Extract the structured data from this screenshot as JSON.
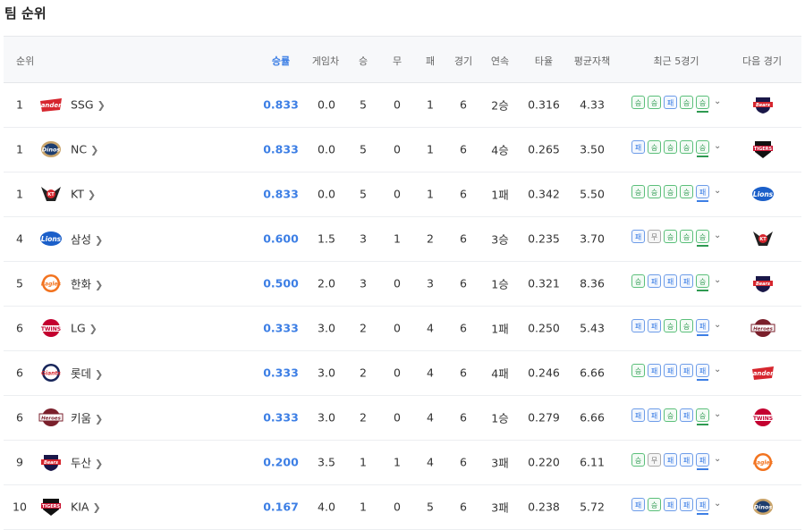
{
  "page": {
    "title": "팀 순위"
  },
  "headers": {
    "rank": "순위",
    "pct": "승률",
    "gb": "게임차",
    "w": "승",
    "d": "무",
    "l": "패",
    "g": "경기",
    "streak": "연속",
    "avg": "타율",
    "era": "평균자책",
    "recent": "최근 5경기",
    "next": "다음 경기"
  },
  "result_labels": {
    "W": "승",
    "L": "패",
    "D": "무"
  },
  "colors": {
    "accent": "#3d7fe5",
    "win": "#2f9a52",
    "loss": "#3d7fe5",
    "draw": "#777777"
  },
  "teams": [
    {
      "rank": "1",
      "name": "SSG",
      "pct": "0.833",
      "gb": "0.0",
      "w": "5",
      "d": "0",
      "l": "1",
      "g": "6",
      "streak": "2승",
      "avg": "0.316",
      "era": "4.33",
      "recent": [
        "W",
        "W",
        "L",
        "W",
        "W"
      ],
      "logo": "ssg-logo-icon",
      "next": "doosan-logo-icon"
    },
    {
      "rank": "1",
      "name": "NC",
      "pct": "0.833",
      "gb": "0.0",
      "w": "5",
      "d": "0",
      "l": "1",
      "g": "6",
      "streak": "4승",
      "avg": "0.265",
      "era": "3.50",
      "recent": [
        "L",
        "W",
        "W",
        "W",
        "W"
      ],
      "logo": "nc-logo-icon",
      "next": "kia-logo-icon"
    },
    {
      "rank": "1",
      "name": "KT",
      "pct": "0.833",
      "gb": "0.0",
      "w": "5",
      "d": "0",
      "l": "1",
      "g": "6",
      "streak": "1패",
      "avg": "0.342",
      "era": "5.50",
      "recent": [
        "W",
        "W",
        "W",
        "W",
        "L"
      ],
      "logo": "kt-logo-icon",
      "next": "samsung-logo-icon"
    },
    {
      "rank": "4",
      "name": "삼성",
      "pct": "0.600",
      "gb": "1.5",
      "w": "3",
      "d": "1",
      "l": "2",
      "g": "6",
      "streak": "3승",
      "avg": "0.235",
      "era": "3.70",
      "recent": [
        "L",
        "D",
        "W",
        "W",
        "W"
      ],
      "logo": "samsung-logo-icon",
      "next": "kt-logo-icon"
    },
    {
      "rank": "5",
      "name": "한화",
      "pct": "0.500",
      "gb": "2.0",
      "w": "3",
      "d": "0",
      "l": "3",
      "g": "6",
      "streak": "1승",
      "avg": "0.321",
      "era": "8.36",
      "recent": [
        "W",
        "L",
        "L",
        "L",
        "W"
      ],
      "logo": "hanwha-logo-icon",
      "next": "doosan-logo-icon"
    },
    {
      "rank": "6",
      "name": "LG",
      "pct": "0.333",
      "gb": "3.0",
      "w": "2",
      "d": "0",
      "l": "4",
      "g": "6",
      "streak": "1패",
      "avg": "0.250",
      "era": "5.43",
      "recent": [
        "L",
        "L",
        "W",
        "W",
        "L"
      ],
      "logo": "lg-logo-icon",
      "next": "kiwoom-logo-icon"
    },
    {
      "rank": "6",
      "name": "롯데",
      "pct": "0.333",
      "gb": "3.0",
      "w": "2",
      "d": "0",
      "l": "4",
      "g": "6",
      "streak": "4패",
      "avg": "0.246",
      "era": "6.66",
      "recent": [
        "W",
        "L",
        "L",
        "L",
        "L"
      ],
      "logo": "lotte-logo-icon",
      "next": "ssg-logo-icon"
    },
    {
      "rank": "6",
      "name": "키움",
      "pct": "0.333",
      "gb": "3.0",
      "w": "2",
      "d": "0",
      "l": "4",
      "g": "6",
      "streak": "1승",
      "avg": "0.279",
      "era": "6.66",
      "recent": [
        "L",
        "L",
        "W",
        "L",
        "W"
      ],
      "logo": "kiwoom-logo-icon",
      "next": "lg-logo-icon"
    },
    {
      "rank": "9",
      "name": "두산",
      "pct": "0.200",
      "gb": "3.5",
      "w": "1",
      "d": "1",
      "l": "4",
      "g": "6",
      "streak": "3패",
      "avg": "0.220",
      "era": "6.11",
      "recent": [
        "W",
        "D",
        "L",
        "L",
        "L"
      ],
      "logo": "doosan-logo-icon",
      "next": "hanwha-logo-icon"
    },
    {
      "rank": "10",
      "name": "KIA",
      "pct": "0.167",
      "gb": "4.0",
      "w": "1",
      "d": "0",
      "l": "5",
      "g": "6",
      "streak": "3패",
      "avg": "0.238",
      "era": "5.72",
      "recent": [
        "L",
        "W",
        "L",
        "L",
        "L"
      ],
      "logo": "kia-logo-icon",
      "next": "nc-logo-icon"
    }
  ]
}
